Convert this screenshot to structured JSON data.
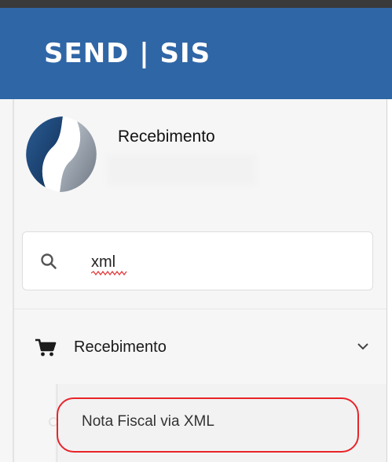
{
  "header": {
    "brand": "SEND | SIS"
  },
  "profile": {
    "name": "Recebimento"
  },
  "search": {
    "value": "xml"
  },
  "menu": {
    "items": [
      {
        "label": "Recebimento",
        "icon": "shopping-cart-icon",
        "expanded": true,
        "children": [
          {
            "label": "Nota Fiscal via XML",
            "highlighted": true
          }
        ]
      }
    ]
  },
  "colors": {
    "brand_bar": "#2f66a6",
    "highlight_outline": "#e8242a",
    "sidebar_bg": "#f6f6f6"
  }
}
